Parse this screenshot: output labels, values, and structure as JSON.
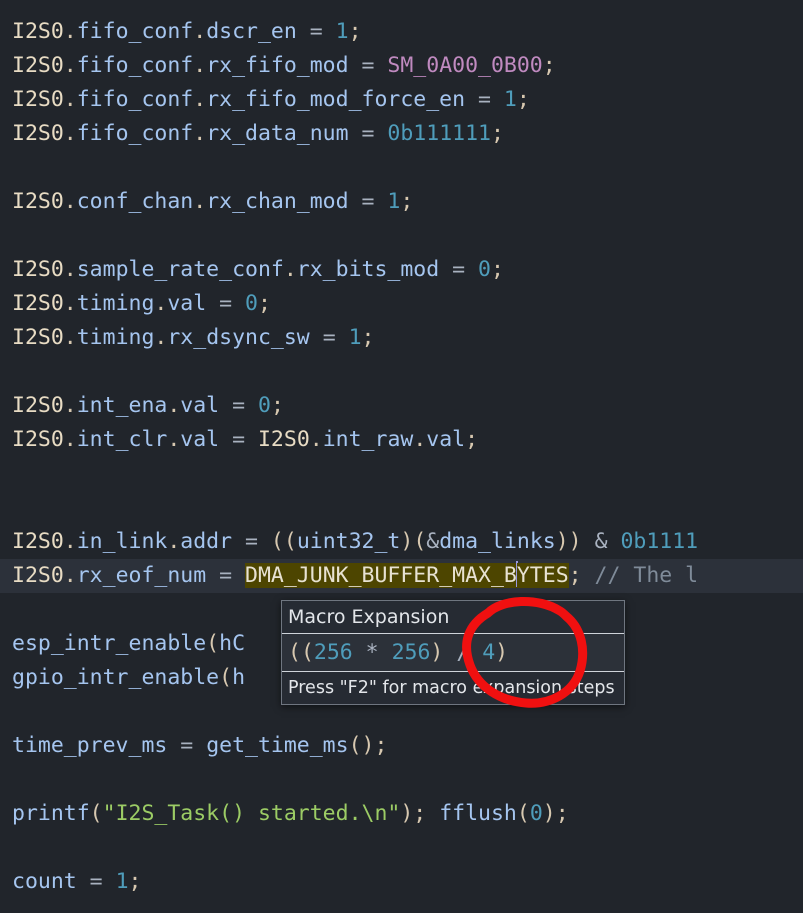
{
  "editor": {
    "theme_background": "#21252b",
    "current_line_background": "#2c313a",
    "selection_background": "#4d4500",
    "lines": [
      {
        "id": 1,
        "text": "I2S0.fifo_conf.dscr_en = 1;"
      },
      {
        "id": 2,
        "text": "I2S0.fifo_conf.rx_fifo_mod = SM_0A00_0B00;"
      },
      {
        "id": 3,
        "text": "I2S0.fifo_conf.rx_fifo_mod_force_en = 1;"
      },
      {
        "id": 4,
        "text": "I2S0.fifo_conf.rx_data_num = 0b111111;"
      },
      {
        "id": 5,
        "text": ""
      },
      {
        "id": 6,
        "text": "I2S0.conf_chan.rx_chan_mod = 1;"
      },
      {
        "id": 7,
        "text": ""
      },
      {
        "id": 8,
        "text": "I2S0.sample_rate_conf.rx_bits_mod = 0;"
      },
      {
        "id": 9,
        "text": "I2S0.timing.val = 0;"
      },
      {
        "id": 10,
        "text": "I2S0.timing.rx_dsync_sw = 1;"
      },
      {
        "id": 11,
        "text": ""
      },
      {
        "id": 12,
        "text": "I2S0.int_ena.val = 0;"
      },
      {
        "id": 13,
        "text": "I2S0.int_clr.val = I2S0.int_raw.val;"
      },
      {
        "id": 14,
        "text": ""
      },
      {
        "id": 15,
        "text": ""
      },
      {
        "id": 16,
        "text": "I2S0.in_link.addr = ((uint32_t)(&dma_links)) & 0b1111"
      },
      {
        "id": 17,
        "text": "I2S0.rx_eof_num = DMA_JUNK_BUFFER_MAX_BYTES; // The l"
      },
      {
        "id": 18,
        "text": ""
      },
      {
        "id": 19,
        "text": "esp_intr_enable(hC"
      },
      {
        "id": 20,
        "text": "gpio_intr_enable(h"
      },
      {
        "id": 21,
        "text": ""
      },
      {
        "id": 22,
        "text": "time_prev_ms = get_time_ms();"
      },
      {
        "id": 23,
        "text": ""
      },
      {
        "id": 24,
        "text": "printf(\"I2S_Task() started.\\n\"); fflush(0);"
      },
      {
        "id": 25,
        "text": ""
      },
      {
        "id": 26,
        "text": "count = 1;"
      }
    ],
    "tokens": {
      "line1": {
        "obj": "I2S0",
        "dot1": ".",
        "mem1": "fifo_conf",
        "dot2": ".",
        "mem2": "dscr_en",
        "eq": " = ",
        "num": "1",
        "semi": ";"
      },
      "line2": {
        "obj": "I2S0",
        "dot1": ".",
        "mem1": "fifo_conf",
        "dot2": ".",
        "mem2": "rx_fifo_mod",
        "eq": " = ",
        "macro": "SM_0A00_0B00",
        "semi": ";"
      },
      "line3": {
        "obj": "I2S0",
        "dot1": ".",
        "mem1": "fifo_conf",
        "dot2": ".",
        "mem2": "rx_fifo_mod_force_en",
        "eq": " = ",
        "num": "1",
        "semi": ";"
      },
      "line4": {
        "obj": "I2S0",
        "dot1": ".",
        "mem1": "fifo_conf",
        "dot2": ".",
        "mem2": "rx_data_num",
        "eq": " = ",
        "num": "0b111111",
        "semi": ";"
      },
      "line6": {
        "obj": "I2S0",
        "dot1": ".",
        "mem1": "conf_chan",
        "dot2": ".",
        "mem2": "rx_chan_mod",
        "eq": " = ",
        "num": "1",
        "semi": ";"
      },
      "line8": {
        "obj": "I2S0",
        "dot1": ".",
        "mem1": "sample_rate_conf",
        "dot2": ".",
        "mem2": "rx_bits_mod",
        "eq": " = ",
        "num": "0",
        "semi": ";"
      },
      "line9": {
        "obj": "I2S0",
        "dot1": ".",
        "mem1": "timing",
        "dot2": ".",
        "mem2": "val",
        "eq": " = ",
        "num": "0",
        "semi": ";"
      },
      "line10": {
        "obj": "I2S0",
        "dot1": ".",
        "mem1": "timing",
        "dot2": ".",
        "mem2": "rx_dsync_sw",
        "eq": " = ",
        "num": "1",
        "semi": ";"
      },
      "line12": {
        "obj": "I2S0",
        "dot1": ".",
        "mem1": "int_ena",
        "dot2": ".",
        "mem2": "val",
        "eq": " = ",
        "num": "0",
        "semi": ";"
      },
      "line13": {
        "obj": "I2S0",
        "dot1": ".",
        "mem1": "int_clr",
        "dot2": ".",
        "mem2": "val",
        "eq": " = ",
        "obj2": "I2S0",
        "dot3": ".",
        "mem3": "int_raw",
        "dot4": ".",
        "mem4": "val",
        "semi": ";"
      },
      "line16": {
        "obj": "I2S0",
        "dot1": ".",
        "mem1": "in_link",
        "dot2": ".",
        "mem2": "addr",
        "eq": " = ",
        "p1": "((",
        "cast": "uint32_t",
        "p2": ")(",
        "amp": "&",
        "var": "dma_links",
        "p3": ")) ",
        "op": "& ",
        "num": "0b1111"
      },
      "line17": {
        "obj": "I2S0",
        "dot1": ".",
        "mem1": "rx_eof_num",
        "eq": " = ",
        "sel": "DMA_JUNK_BUFFER_MAX_B",
        "sel2": "YTES",
        "semi": ";",
        "comment": " // The l"
      },
      "line19": {
        "fn": "esp_intr_enable",
        "paren": "(",
        "arg": "hC"
      },
      "line20": {
        "fn": "gpio_intr_enable",
        "paren": "(",
        "arg": "h"
      },
      "line22": {
        "var": "time_prev_ms",
        "eq": " = ",
        "fn": "get_time_ms",
        "paren": "();"
      },
      "line24": {
        "fn": "printf",
        "p1": "(",
        "str": "\"I2S_Task() started.\\n\"",
        "p2": "); ",
        "fn2": "fflush",
        "p3": "(",
        "num": "0",
        "p4": ");"
      },
      "line26": {
        "var": "count",
        "eq": " = ",
        "num": "1",
        "semi": ";"
      }
    }
  },
  "tooltip": {
    "title": "Macro Expansion",
    "expansion_open": "((",
    "expansion_a": "256",
    "expansion_mul": " * ",
    "expansion_b": "256",
    "expansion_close1": ")",
    "expansion_div": " / ",
    "expansion_c": "4",
    "expansion_close2": ")",
    "hint": "Press \"F2\" for macro expansion steps",
    "border_color": "#6f7680",
    "background": "#262b33"
  },
  "annotation": {
    "type": "hand-drawn-circle",
    "color": "#f01010",
    "target": "macro expansion value ( / 4 )"
  }
}
